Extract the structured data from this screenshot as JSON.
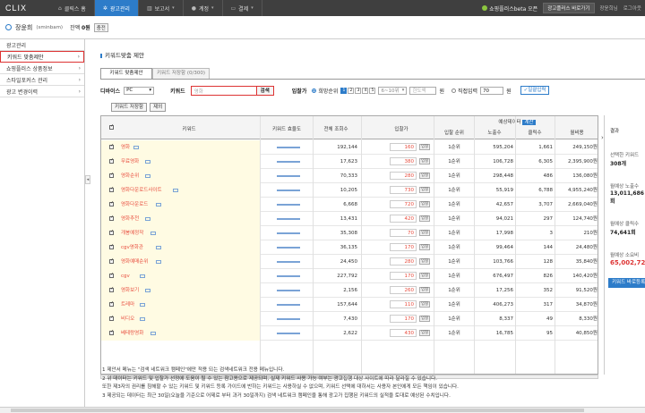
{
  "nav": {
    "logo": "CLIX",
    "tabs": [
      {
        "label": "클릭스 홈",
        "icon": "home-icon",
        "active": false
      },
      {
        "label": "광고관리",
        "icon": "gear-icon",
        "active": true
      },
      {
        "label": "보고서",
        "icon": "chart-icon",
        "active": false
      },
      {
        "label": "계정",
        "icon": "user-icon",
        "active": false
      },
      {
        "label": "결제",
        "icon": "card-icon",
        "active": false
      }
    ],
    "promo": "쇼핑플러스beta 오픈",
    "promo_button": "광고플러스 바로가기",
    "links": [
      "장윤희님",
      "로그아웃"
    ]
  },
  "user": {
    "name": "장윤희",
    "id": "(sminbam)",
    "balance_label": "잔액",
    "balance_value": "0원",
    "charge_button": "충전"
  },
  "sidebar": {
    "items": [
      {
        "label": "광고관리",
        "active": false,
        "chevron": false
      },
      {
        "label": "키워드 맞춤제안",
        "active": true,
        "chevron": true
      },
      {
        "label": "쇼핑플러스 상품정보",
        "active": false,
        "chevron": true
      },
      {
        "label": "스타일포커스 관리",
        "active": false,
        "chevron": true
      },
      {
        "label": "광고 변경이력",
        "active": false,
        "chevron": true
      }
    ]
  },
  "main": {
    "title": "키워드맞춤 제안",
    "tabs": [
      "키워드 맞춤제안",
      "키워드 저장함 (0/300)"
    ],
    "filter": {
      "device_label": "디바이스",
      "device_value": "PC",
      "keyword_label": "키워드",
      "keyword_placeholder": "영화",
      "search_button": "검색",
      "bid_label": "입찰가",
      "option_rank": "희망순위",
      "pages": [
        "1",
        "2",
        "3",
        "4",
        "5"
      ],
      "rank_select": "6~10위",
      "bid_input_placeholder": "한도액",
      "won": "원",
      "option_direct": "직접입력",
      "direct_value": "70",
      "apply_button": "일괄입력"
    },
    "actions": [
      "키워드 저장함",
      "제외"
    ]
  },
  "table": {
    "headers": {
      "keyword": "키워드",
      "bar": "키워드 효율도",
      "search": "전체 조회수",
      "bid": "입찰가",
      "estimate": "예상데이터",
      "estimate_tag": "계산",
      "rank": "입찰 순위",
      "impressions": "노출수",
      "clicks": "클릭수",
      "cost": "월비용"
    },
    "bid_button": "입찰",
    "rows": [
      {
        "kw": "영화",
        "search": "192,144",
        "bid": "160",
        "rank": "1순위",
        "imp": "595,204",
        "clicks": "1,661",
        "cost": "249,150원"
      },
      {
        "kw": "무료영화",
        "search": "17,623",
        "bid": "380",
        "rank": "1순위",
        "imp": "106,728",
        "clicks": "6,305",
        "cost": "2,395,900원"
      },
      {
        "kw": "영화순위",
        "search": "70,333",
        "bid": "280",
        "rank": "1순위",
        "imp": "298,448",
        "clicks": "486",
        "cost": "136,080원"
      },
      {
        "kw": "영화다운로드사이트",
        "search": "10,205",
        "bid": "730",
        "rank": "1순위",
        "imp": "55,919",
        "clicks": "6,788",
        "cost": "4,955,240원"
      },
      {
        "kw": "영화다운로드",
        "search": "6,668",
        "bid": "720",
        "rank": "1순위",
        "imp": "42,657",
        "clicks": "3,707",
        "cost": "2,669,040원"
      },
      {
        "kw": "영화추천",
        "search": "13,431",
        "bid": "420",
        "rank": "1순위",
        "imp": "94,021",
        "clicks": "297",
        "cost": "124,740원"
      },
      {
        "kw": "개봉예정작",
        "search": "35,308",
        "bid": "70",
        "rank": "1순위",
        "imp": "17,998",
        "clicks": "3",
        "cost": "210원"
      },
      {
        "kw": "cgv영화관",
        "search": "36,135",
        "bid": "170",
        "rank": "1순위",
        "imp": "99,464",
        "clicks": "144",
        "cost": "24,480원"
      },
      {
        "kw": "영화예매순위",
        "search": "24,450",
        "bid": "280",
        "rank": "1순위",
        "imp": "103,766",
        "clicks": "128",
        "cost": "35,840원"
      },
      {
        "kw": "cgv",
        "search": "227,792",
        "bid": "170",
        "rank": "1순위",
        "imp": "676,497",
        "clicks": "826",
        "cost": "140,420원"
      },
      {
        "kw": "영화보기",
        "search": "2,156",
        "bid": "260",
        "rank": "1순위",
        "imp": "17,256",
        "clicks": "352",
        "cost": "91,520원"
      },
      {
        "kw": "트레마",
        "search": "157,644",
        "bid": "110",
        "rank": "1순위",
        "imp": "406,273",
        "clicks": "317",
        "cost": "34,870원"
      },
      {
        "kw": "비디오",
        "search": "7,430",
        "bid": "170",
        "rank": "1순위",
        "imp": "8,337",
        "clicks": "49",
        "cost": "8,330원"
      },
      {
        "kw": "베테랑영화",
        "search": "2,622",
        "bid": "430",
        "rank": "1순위",
        "imp": "16,785",
        "clicks": "95",
        "cost": "40,850원"
      }
    ]
  },
  "rpanel": {
    "head": "결과",
    "selected_label": "선택한 키워드",
    "selected_value": "308개",
    "imp_label": "월예상 노출수",
    "imp_value": "13,011,686회",
    "click_label": "월예상 클릭수",
    "click_value": "74,641회",
    "cost_label": "월예상 소요비",
    "cost_value": "65,002,720",
    "button": "키워드 바로등록"
  },
  "notes": [
    "1  제안서 메뉴는 \"검색 네트워크 캠페인\"에만 적용 되는 검색네트워크 전용 메뉴입니다.",
    "2  위 데이터는 키워드 및 입찰가 선정에 도움이 될 수 있는 참고용으로 제공되며, 실제 키워드 사용 가능 여부는 광고집행 대상 사이트에 따라 달라질 수 있습니다.",
    "    또한 제3자의 권리를 침해할 수 있는 키워드 및 키워드 등록 가이드에 반하는 키워드는 사용하실 수 없으며, 키워드 선택에 대하서는 사용자 본인에게 모든 책임이 있습니다.",
    "3  제공되는 데이터는 최근 30일(오늘을 기준으로 어제로 부터 과거 30일까지) 검색 네트워크 캠페인을 통해 광고가 집행된 키워드의 실적을 토대로 예상된 수치입니다."
  ],
  "colors": {
    "accent": "#2d7cc9",
    "highlight": "#e84c3d",
    "kw_bg": "#fffbe3"
  }
}
